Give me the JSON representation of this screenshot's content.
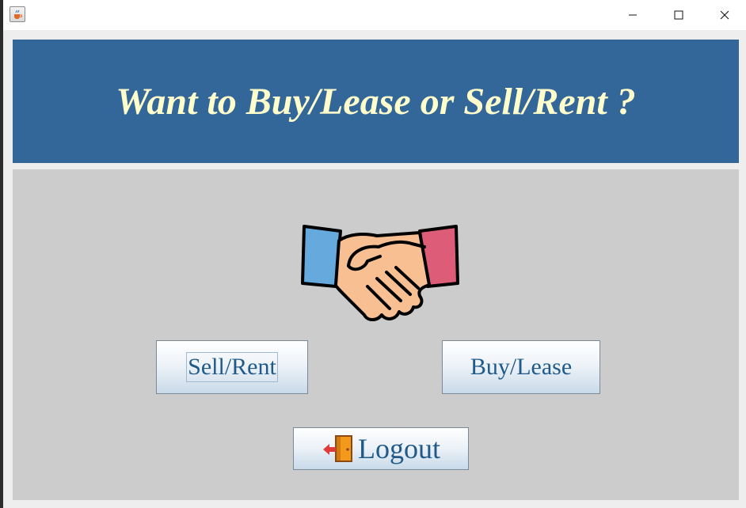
{
  "window": {
    "icons": {
      "app": "java-cup-icon",
      "minimize": "minimize-icon",
      "maximize": "maximize-icon",
      "close": "close-icon"
    }
  },
  "header": {
    "title": "Want to Buy/Lease or Sell/Rent ?"
  },
  "main": {
    "image": "handshake-icon",
    "sell_button_label": "Sell/Rent",
    "buy_button_label": "Buy/Lease",
    "logout_button_label": "Logout",
    "logout_icon": "logout-door-icon"
  },
  "colors": {
    "header_bg": "#336699",
    "header_text": "#ffffcc",
    "body_bg": "#cccccc",
    "button_text": "#1f5a8a"
  }
}
